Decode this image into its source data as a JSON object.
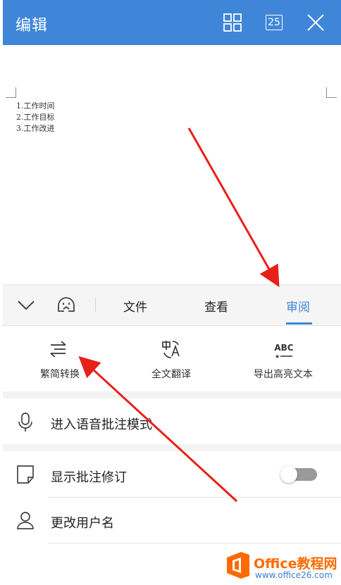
{
  "header": {
    "title": "编辑",
    "page_count": "25",
    "icons": [
      "grid-icon",
      "page-count-icon",
      "close-icon"
    ]
  },
  "document": {
    "lines": [
      "1.工作时间",
      "2.工作目标",
      "3.工作改进"
    ]
  },
  "toolbar": {
    "collapse_icon": "chevron-down-icon",
    "assistant_icon": "assistant-icon",
    "tabs": [
      {
        "label": "文件",
        "active": false
      },
      {
        "label": "查看",
        "active": false
      },
      {
        "label": "审阅",
        "active": true
      }
    ],
    "accent_color": "#3f86d8"
  },
  "tools": [
    {
      "label": "繁简转换",
      "icon": "convert-icon"
    },
    {
      "label": "全文翻译",
      "icon": "translate-icon"
    },
    {
      "label": "导出高亮文本",
      "icon": "abc-export-icon",
      "icon_text": "ABC"
    }
  ],
  "rows": [
    {
      "label": "进入语音批注模式",
      "icon": "microphone-icon"
    },
    {
      "label": "显示批注修订",
      "icon": "note-icon",
      "toggle_on": false
    },
    {
      "label": "更改用户名",
      "icon": "user-icon"
    }
  ],
  "watermark": {
    "brand": "Office教程网",
    "url": "www.office26.com"
  }
}
